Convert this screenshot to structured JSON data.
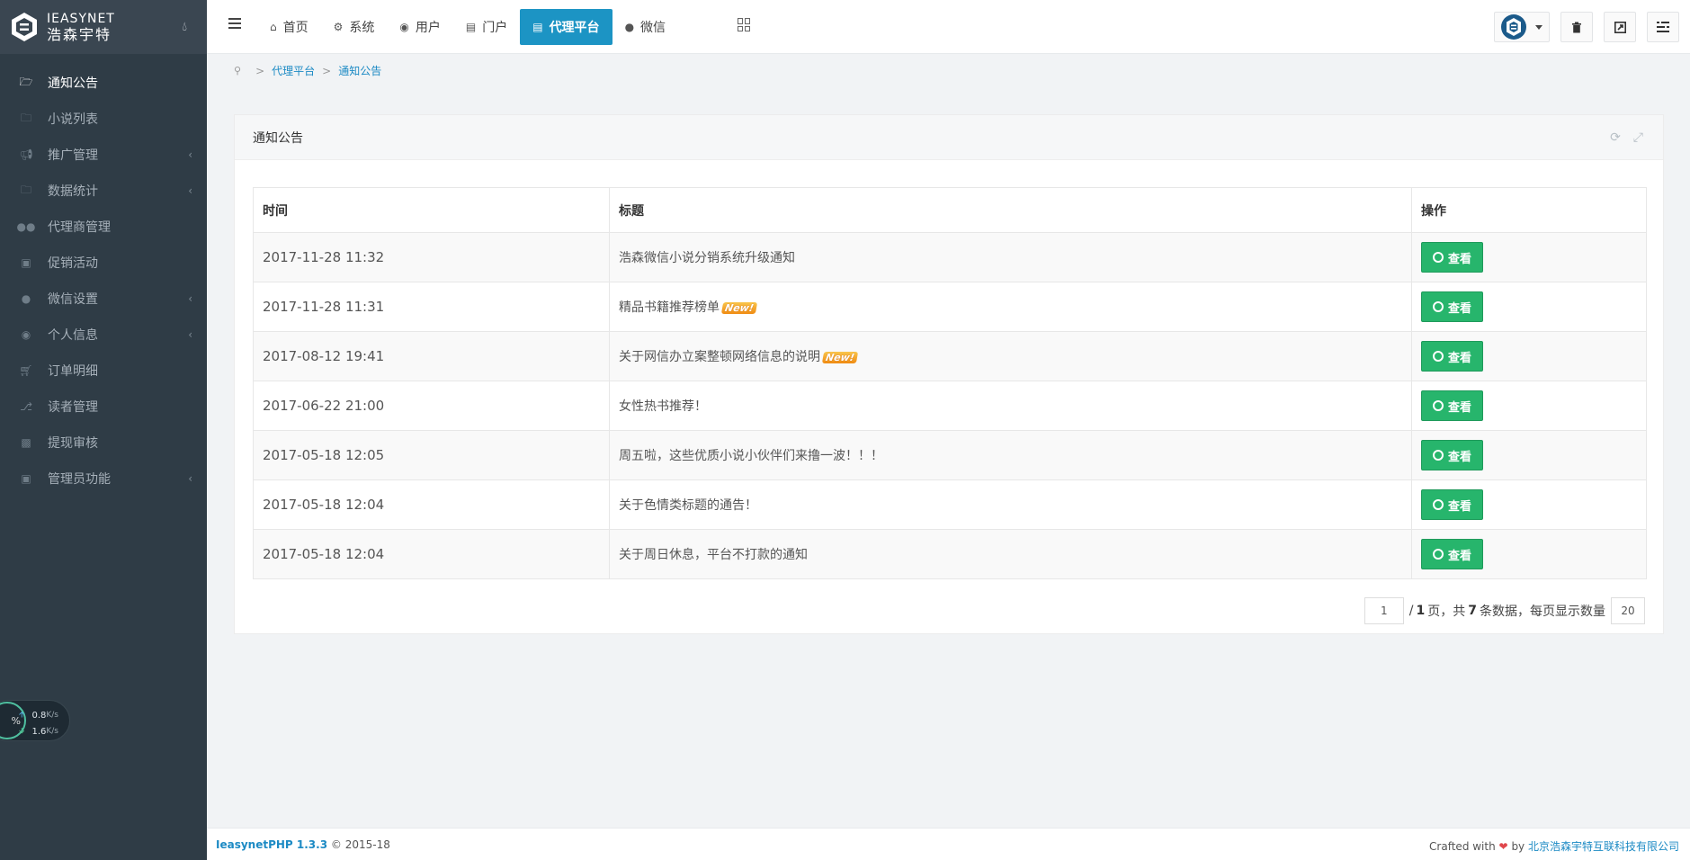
{
  "brand": {
    "name_en": "IEASYNET",
    "name_cn": "浩森宇特"
  },
  "sidebar": {
    "items": [
      {
        "label": "通知公告",
        "icon": "folder-open-icon",
        "active": true,
        "has_arrow": false
      },
      {
        "label": "小说列表",
        "icon": "folder-icon",
        "active": false,
        "has_arrow": false
      },
      {
        "label": "推广管理",
        "icon": "bullhorn-icon",
        "active": false,
        "has_arrow": true
      },
      {
        "label": "数据统计",
        "icon": "folder-icon",
        "active": false,
        "has_arrow": true
      },
      {
        "label": "代理商管理",
        "icon": "users-icon",
        "active": false,
        "has_arrow": false
      },
      {
        "label": "促销活动",
        "icon": "gift-icon",
        "active": false,
        "has_arrow": false
      },
      {
        "label": "微信设置",
        "icon": "wechat-icon",
        "active": false,
        "has_arrow": true
      },
      {
        "label": "个人信息",
        "icon": "user-icon",
        "active": false,
        "has_arrow": true
      },
      {
        "label": "订单明细",
        "icon": "cart-icon",
        "active": false,
        "has_arrow": false
      },
      {
        "label": "读者管理",
        "icon": "headphones-icon",
        "active": false,
        "has_arrow": false
      },
      {
        "label": "提现审核",
        "icon": "money-icon",
        "active": false,
        "has_arrow": false
      },
      {
        "label": "管理员功能",
        "icon": "lock-icon",
        "active": false,
        "has_arrow": true
      }
    ]
  },
  "netmon": {
    "percent": "%",
    "up": "0.8",
    "down": "1.6",
    "unit": "K/s"
  },
  "topnav": {
    "items": [
      {
        "label": "首页",
        "icon": "home-icon",
        "active": false
      },
      {
        "label": "系统",
        "icon": "gear-icon",
        "active": false
      },
      {
        "label": "用户",
        "icon": "user-icon",
        "active": false
      },
      {
        "label": "门户",
        "icon": "newspaper-icon",
        "active": false
      },
      {
        "label": "代理平台",
        "icon": "id-card-icon",
        "active": true
      },
      {
        "label": "微信",
        "icon": "wechat-icon",
        "active": false
      }
    ]
  },
  "breadcrumb": {
    "items": [
      "代理平台",
      "通知公告"
    ]
  },
  "panel": {
    "title": "通知公告",
    "columns": [
      "时间",
      "标题",
      "操作"
    ],
    "view_label": "查看",
    "new_badge": "New!",
    "rows": [
      {
        "time": "2017-11-28 11:32",
        "title": "浩森微信小说分销系统升级通知",
        "is_new": false
      },
      {
        "time": "2017-11-28 11:31",
        "title": "精品书籍推荐榜单",
        "is_new": true
      },
      {
        "time": "2017-08-12 19:41",
        "title": "关于网信办立案整顿网络信息的说明",
        "is_new": true
      },
      {
        "time": "2017-06-22 21:00",
        "title": "女性热书推荐！",
        "is_new": false
      },
      {
        "time": "2017-05-18 12:05",
        "title": "周五啦，这些优质小说小伙伴们来撸一波！！！",
        "is_new": false
      },
      {
        "time": "2017-05-18 12:04",
        "title": "关于色情类标题的通告！",
        "is_new": false
      },
      {
        "time": "2017-05-18 12:04",
        "title": "关于周日休息，平台不打款的通知",
        "is_new": false
      }
    ]
  },
  "pager": {
    "current_page": "1",
    "text_pages_prefix": "/",
    "total_pages": "1",
    "text_pages_suffix": "页，共",
    "total_records": "7",
    "text_records_suffix": "条数据，每页显示数量",
    "page_size": "20"
  },
  "footer": {
    "app_name": "IeasynetPHP 1.3.3",
    "copyright": "© 2015-18",
    "crafted": "Crafted with",
    "by": "by",
    "company": "北京浩森宇特互联科技有限公司"
  },
  "colors": {
    "sidebar_bg": "#2f3c46",
    "accent": "#1c94c4",
    "view_button": "#27b56c",
    "link": "#1c8ac4"
  }
}
